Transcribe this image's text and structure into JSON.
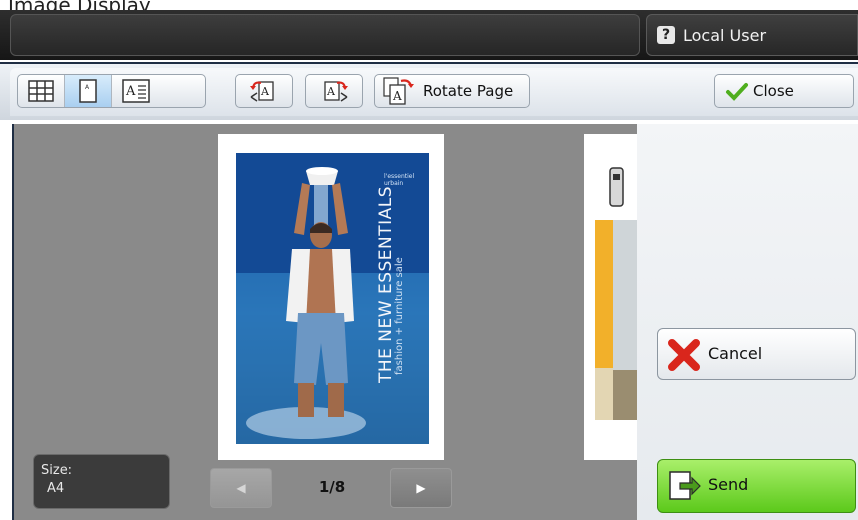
{
  "header": {
    "heading": "Image Display",
    "user_label": "Local User",
    "user_icon": "key-user-icon"
  },
  "toolbar": {
    "view_modes": [
      {
        "name": "thumbnail-grid-view",
        "icon": "grid-icon",
        "active": false
      },
      {
        "name": "single-page-view",
        "icon": "page-icon",
        "active": true
      },
      {
        "name": "page-detail-view",
        "icon": "page-text-icon",
        "active": false
      }
    ],
    "rotate_left_icon": "rotate-left-icon",
    "rotate_right_icon": "rotate-right-icon",
    "rotate_page_label": "Rotate Page",
    "close_label": "Close"
  },
  "preview": {
    "poster_brand": "l'essentiel urbain",
    "poster_title": "THE NEW ESSENTIALS",
    "poster_subtitle": "fashion + furniture sale",
    "size_label": "Size:",
    "size_value": "A4",
    "page_indicator": "1/8"
  },
  "actions": {
    "cancel_label": "Cancel",
    "send_label": "Send"
  },
  "colors": {
    "accent_blue": "#1f2e44",
    "send_green": "#5cc91b",
    "cancel_red": "#d9261c",
    "preview_gray": "#8a8a8a"
  }
}
